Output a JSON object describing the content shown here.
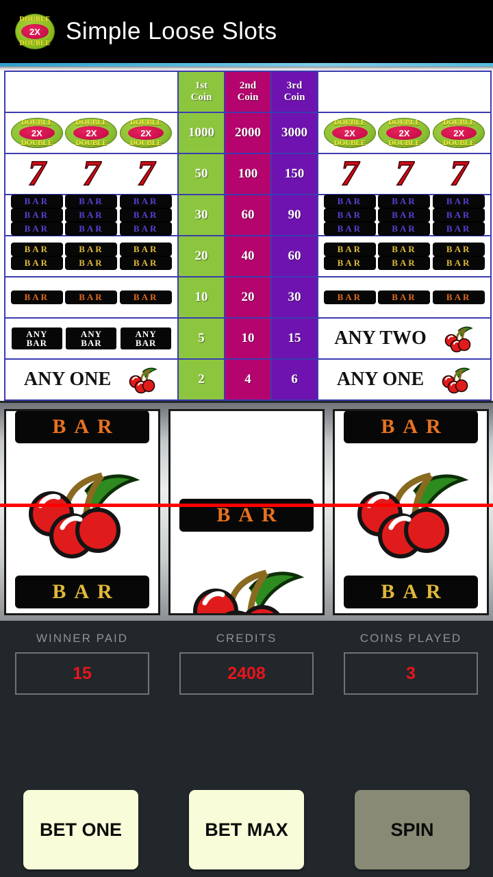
{
  "header": {
    "title": "Simple Loose Slots",
    "logo": {
      "top_text": "DOUBLE",
      "bottom_text": "DOUBLE",
      "center_text": "2X"
    },
    "accent_color": "#52b8dd"
  },
  "paytable": {
    "coin_headers": [
      "1st\nCoin",
      "2nd\nCoin",
      "3rd\nCoin"
    ],
    "coin_header_lines": [
      {
        "line1": "1st",
        "line2": "Coin"
      },
      {
        "line1": "2nd",
        "line2": "Coin"
      },
      {
        "line1": "3rd",
        "line2": "Coin"
      }
    ],
    "column_colors": {
      "first": "#8cc63f",
      "second": "#b5046e",
      "third": "#6f13b0"
    },
    "border_color": "#3b3bb0",
    "rows": [
      {
        "symbol": "double-2x",
        "left_labels": [
          "2X",
          "2X",
          "2X"
        ],
        "right_labels": [
          "2X",
          "2X",
          "2X"
        ],
        "badge_top": "DOUBLE",
        "badge_bottom": "DOUBLE",
        "pay": [
          "1000",
          "2000",
          "3000"
        ]
      },
      {
        "symbol": "seven",
        "left_labels": [
          "7",
          "7",
          "7"
        ],
        "right_labels": [
          "7",
          "7",
          "7"
        ],
        "pay": [
          "50",
          "100",
          "150"
        ]
      },
      {
        "symbol": "triple-bar",
        "bar_text": "BAR",
        "bar_lines": 3,
        "pay": [
          "30",
          "60",
          "90"
        ]
      },
      {
        "symbol": "double-bar",
        "bar_text": "BAR",
        "bar_lines": 2,
        "pay": [
          "20",
          "40",
          "60"
        ]
      },
      {
        "symbol": "single-bar",
        "bar_text": "BAR",
        "bar_lines": 1,
        "pay": [
          "10",
          "20",
          "30"
        ]
      },
      {
        "symbol": "any-bar",
        "any_bar_line1": "ANY",
        "any_bar_line2": "BAR",
        "right_text": "ANY TWO",
        "pay": [
          "5",
          "10",
          "15"
        ]
      },
      {
        "symbol": "any-one-cherry",
        "left_text": "ANY ONE",
        "right_text": "ANY ONE",
        "pay": [
          "2",
          "4",
          "6"
        ]
      }
    ]
  },
  "reels": {
    "payline_color": "#ff0000",
    "bar_text": "BAR",
    "columns": [
      {
        "top": "BAR",
        "middle": "cherries",
        "bottom": "BAR"
      },
      {
        "top": "",
        "middle": "BAR",
        "bottom": "cherries"
      },
      {
        "top": "BAR",
        "middle": "cherries",
        "bottom": "BAR"
      }
    ]
  },
  "stats": [
    {
      "label": "WINNER PAID",
      "value": "15"
    },
    {
      "label": "CREDITS",
      "value": "2408"
    },
    {
      "label": "COINS PLAYED",
      "value": "3"
    }
  ],
  "buttons": [
    {
      "label": "BET ONE",
      "style": "bet"
    },
    {
      "label": "BET MAX",
      "style": "bet"
    },
    {
      "label": "SPIN",
      "style": "spin"
    }
  ]
}
